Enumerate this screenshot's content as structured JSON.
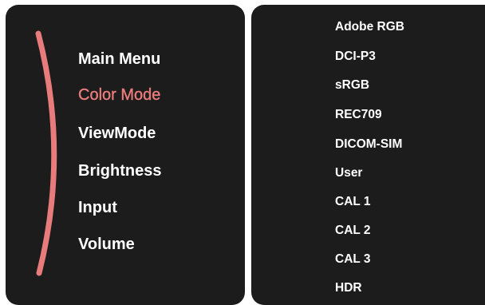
{
  "colors": {
    "panel_background": "#1c1c1c",
    "page_background": "#ffffff",
    "text": "#ffffff",
    "accent": "#e87b7b"
  },
  "main_menu": {
    "active_index": 1,
    "items": [
      {
        "label": "Main Menu"
      },
      {
        "label": "Color Mode"
      },
      {
        "label": "ViewMode"
      },
      {
        "label": "Brightness"
      },
      {
        "label": "Input"
      },
      {
        "label": "Volume"
      }
    ]
  },
  "color_mode_menu": {
    "items": [
      {
        "label": "Adobe RGB"
      },
      {
        "label": "DCI-P3"
      },
      {
        "label": "sRGB"
      },
      {
        "label": "REC709"
      },
      {
        "label": "DICOM-SIM"
      },
      {
        "label": "User"
      },
      {
        "label": "CAL 1"
      },
      {
        "label": "CAL 2"
      },
      {
        "label": "CAL 3"
      },
      {
        "label": "HDR"
      }
    ]
  }
}
